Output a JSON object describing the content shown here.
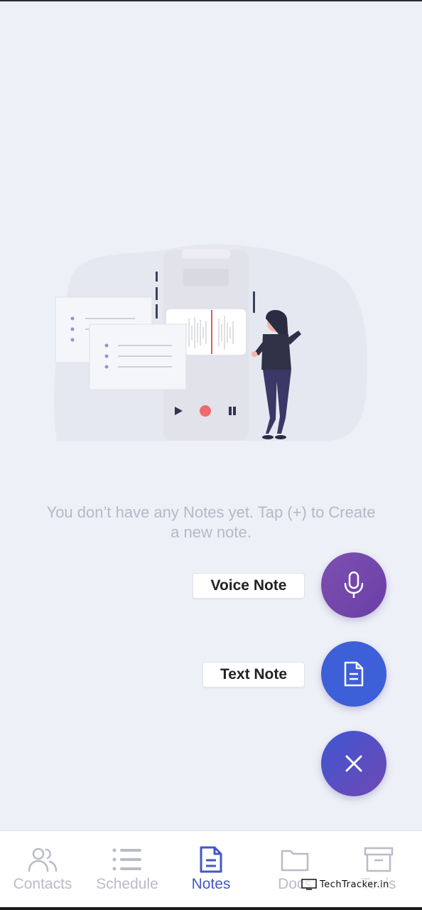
{
  "empty_state": {
    "message": "You don’t have any Notes yet. Tap (+) to Create a new note."
  },
  "fab_menu": {
    "voice_note_label": "Voice Note",
    "text_note_label": "Text Note",
    "voice_icon": "microphone-icon",
    "text_icon": "document-icon",
    "close_icon": "close-icon"
  },
  "bottom_nav": {
    "items": [
      {
        "label": "Contacts",
        "icon": "contacts-icon",
        "active": false
      },
      {
        "label": "Schedule",
        "icon": "list-icon",
        "active": false
      },
      {
        "label": "Notes",
        "icon": "notes-icon",
        "active": true
      },
      {
        "label": "Docs",
        "icon": "folder-icon",
        "active": false
      },
      {
        "label": "Tools",
        "icon": "archive-icon",
        "active": false
      }
    ]
  },
  "watermark": "TechTracker.in",
  "colors": {
    "background": "#eef0f8",
    "active_nav": "#4257c9",
    "voice_fab": "#7d4fb0",
    "text_fab": "#3d5fd8"
  }
}
